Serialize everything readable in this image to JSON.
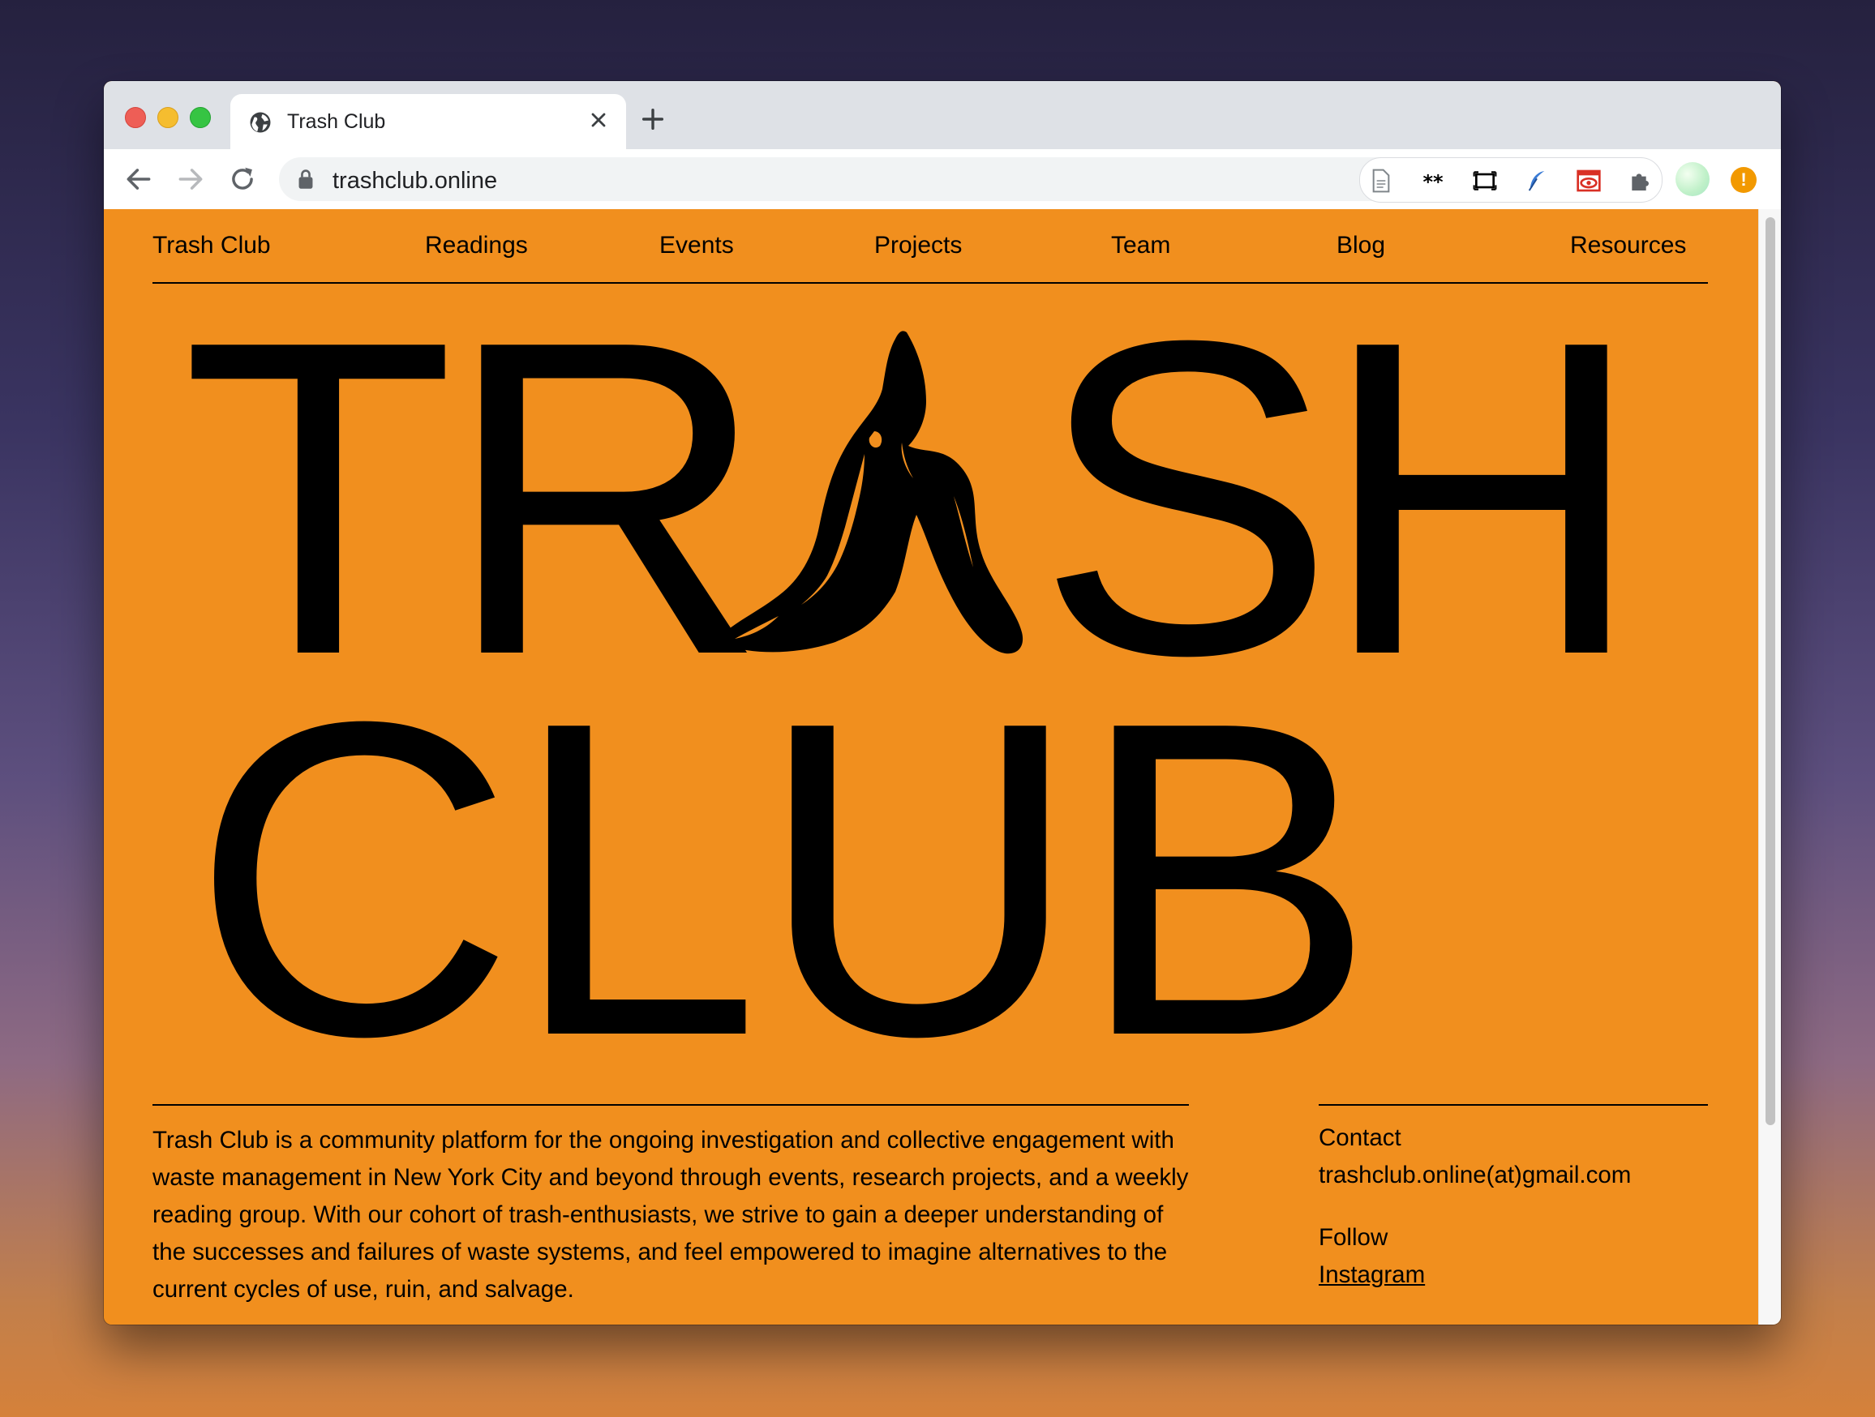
{
  "browser": {
    "tab_title": "Trash Club",
    "url": "trashclub.online"
  },
  "nav": {
    "items": [
      "Trash Club",
      "Readings",
      "Events",
      "Projects",
      "Team",
      "Blog",
      "Resources"
    ]
  },
  "hero": {
    "line1": {
      "t": "T",
      "r": "R",
      "s": "S",
      "h": "H"
    },
    "line2": "CLUB"
  },
  "about": {
    "text": "Trash Club is a community platform for the ongoing investigation and collective engagement with waste management in New York City and beyond through events, research projects, and a weekly reading group. With our cohort of trash-enthusiasts, we strive to gain a deeper understanding of the successes and failures of waste systems, and feel empowered to imagine alternatives to the current cycles of use, ruin, and salvage."
  },
  "contact": {
    "heading": "Contact",
    "email": "trashclub.online(at)gmail.com"
  },
  "follow": {
    "heading": "Follow",
    "link": "Instagram"
  },
  "colors": {
    "page_bg": "#f18f1e",
    "text": "#000000"
  }
}
